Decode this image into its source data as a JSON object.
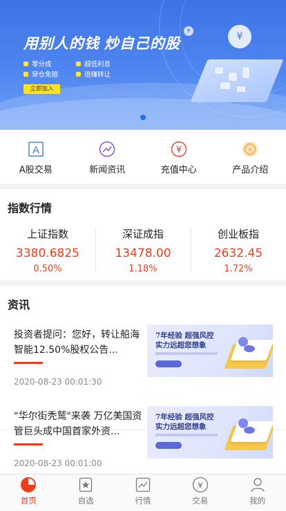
{
  "banner": {
    "headline": "用别人的钱 炒自己的股",
    "features": [
      "零分成",
      "超低利息",
      "穿仓免赔",
      "倍赚转让"
    ],
    "join_label": "立即加入",
    "coin_symbol": "¥",
    "active_slide": 1,
    "slides": 1
  },
  "quick_menu": [
    {
      "label": "A股交易",
      "icon": "a-share-icon",
      "color": "#3a7ee8"
    },
    {
      "label": "新闻资讯",
      "icon": "trend-icon",
      "color": "#7b4ad8"
    },
    {
      "label": "充值中心",
      "icon": "yen-icon",
      "color": "#e23b2a"
    },
    {
      "label": "产品介绍",
      "icon": "product-icon",
      "color": "#f5a43a"
    }
  ],
  "index_section": {
    "title": "指数行情",
    "items": [
      {
        "name": "上证指数",
        "value": "3380.6825",
        "change": "0.50%"
      },
      {
        "name": "深证成指",
        "value": "13478.00",
        "change": "1.18%"
      },
      {
        "name": "创业板指",
        "value": "2632.45",
        "change": "1.72%"
      }
    ]
  },
  "news_section": {
    "title": "资讯",
    "items": [
      {
        "title": "投资者提问：您好，转让船海智能12.50%股权公告...",
        "date": "2020-08-23 00:01:30",
        "thumb_line1": "7年经验  超强风控",
        "thumb_line2": "实力远超您想象"
      },
      {
        "title": "\"华尔街秃鹫\"来袭 万亿美国资管巨头成中国首家外资...",
        "date": "2020-08-23 00:01:00",
        "thumb_line1": "7年经验  超强风控",
        "thumb_line2": "实力远超您想象"
      }
    ]
  },
  "tabbar": [
    {
      "label": "首页",
      "icon": "home-icon",
      "active": true
    },
    {
      "label": "自选",
      "icon": "star-icon",
      "active": false
    },
    {
      "label": "行情",
      "icon": "chart-icon",
      "active": false
    },
    {
      "label": "交易",
      "icon": "yen-circle-icon",
      "active": false
    },
    {
      "label": "我的",
      "icon": "user-icon",
      "active": false
    }
  ],
  "colors": {
    "accent": "#e8401f",
    "banner_blue": "#3d73e6"
  }
}
